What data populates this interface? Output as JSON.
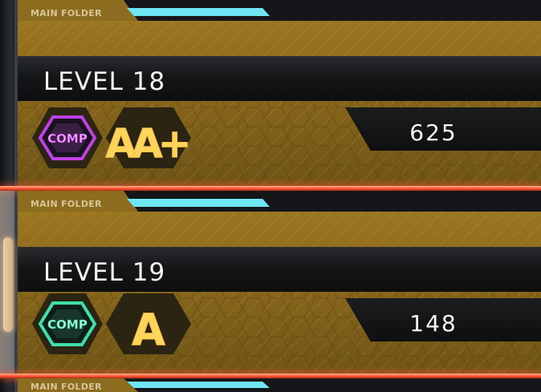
{
  "cards": [
    {
      "folder_label": "MAIN FOLDER",
      "level_label": "LEVEL 18",
      "clear_badge": "COMP",
      "clear_color": "#c040e8",
      "grade": "AA+",
      "score": "625",
      "selected": false
    },
    {
      "folder_label": "MAIN FOLDER",
      "level_label": "LEVEL 19",
      "clear_badge": "COMP",
      "clear_color": "#3de0a8",
      "grade": "A",
      "score": "148",
      "selected": true
    },
    {
      "folder_label": "MAIN FOLDER"
    }
  ],
  "colors": {
    "gold": "#8e6b1c",
    "cyan_accent": "#6fe6f4",
    "selection_red": "#ff5a3a",
    "selection_orange": "#ffb257"
  }
}
